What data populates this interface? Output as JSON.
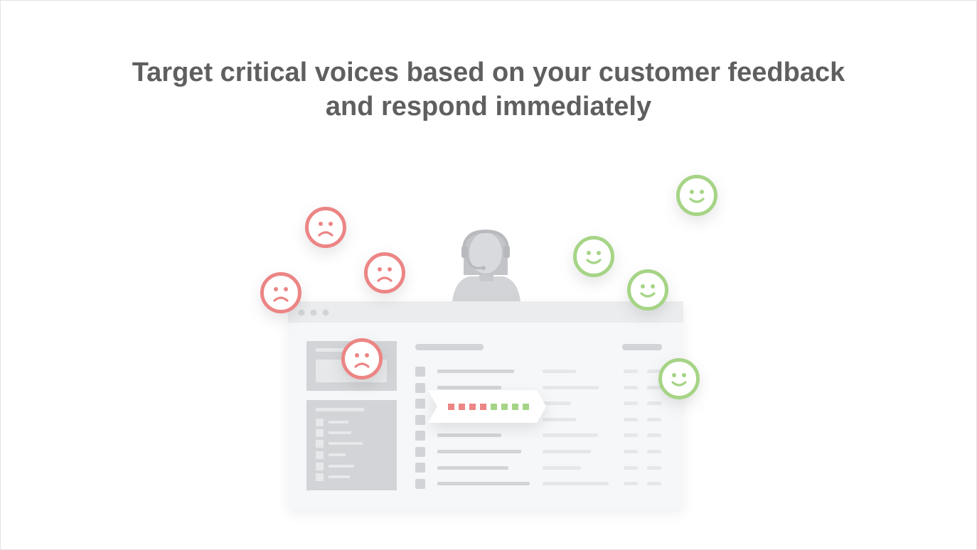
{
  "headline": {
    "line1": "Target critical voices based on your customer feedback",
    "line2": "and respond immediately"
  },
  "illustration": {
    "negative_icon": "sad-face-icon",
    "positive_icon": "smiley-face-icon",
    "agent_icon": "support-agent-icon",
    "sentiment_scale": [
      "negative",
      "negative",
      "negative",
      "negative",
      "positive",
      "positive",
      "positive",
      "positive"
    ]
  },
  "colors": {
    "headline": "#5f5f5f",
    "negative": "#ec8585",
    "positive": "#a6d486",
    "window_frame": "#ebecee",
    "placeholder": "#d3d4d7"
  }
}
